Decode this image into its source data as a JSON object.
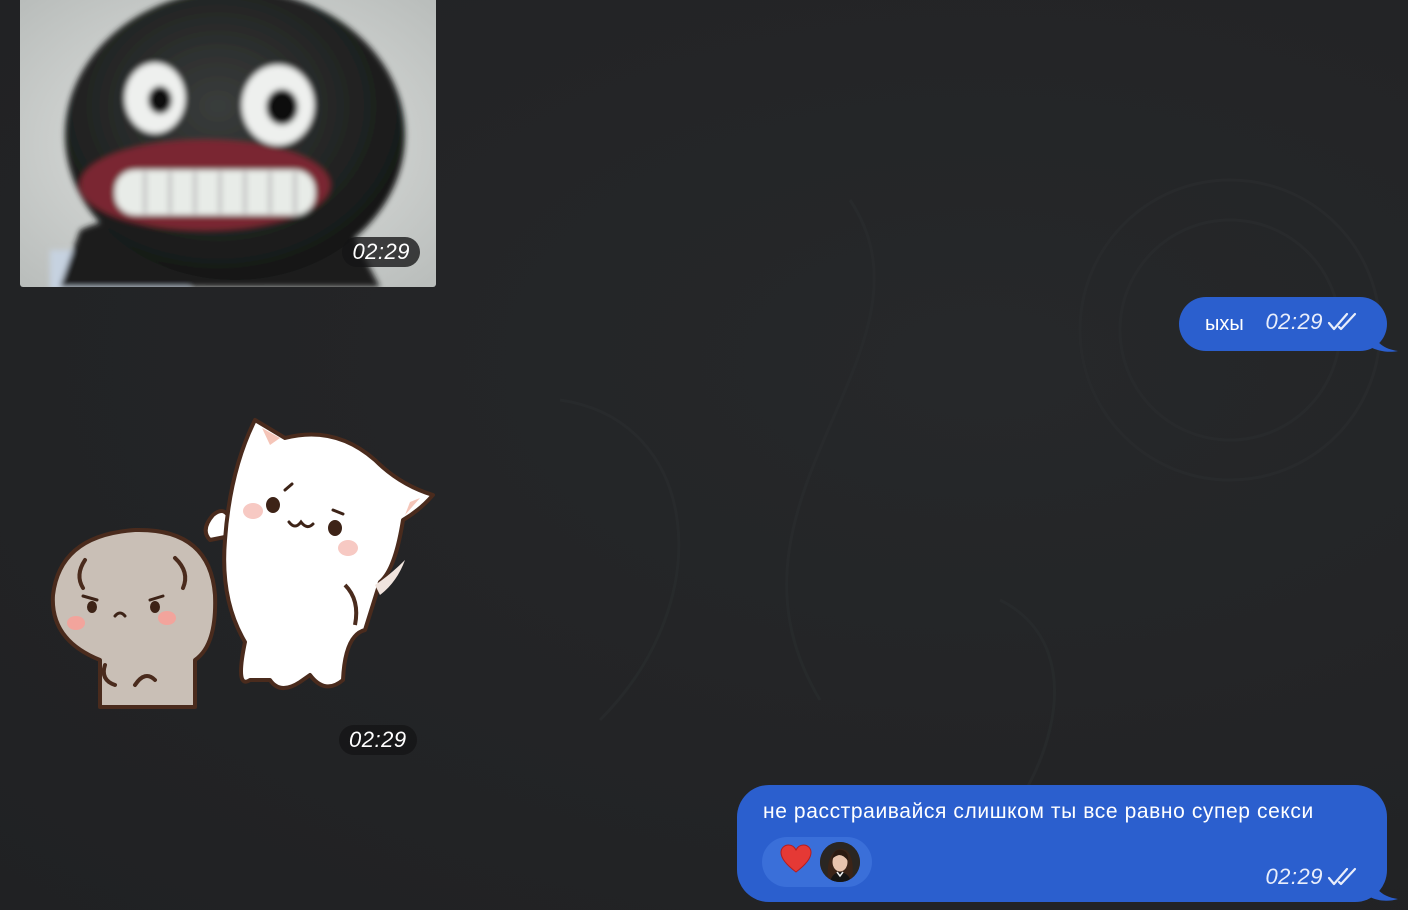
{
  "messages": [
    {
      "kind": "photo",
      "direction": "incoming",
      "time": "02:29"
    },
    {
      "kind": "text",
      "direction": "outgoing",
      "text": "ыхы",
      "time": "02:29",
      "status": "read"
    },
    {
      "kind": "sticker",
      "direction": "incoming",
      "time": "02:29"
    },
    {
      "kind": "text",
      "direction": "outgoing",
      "text": "не расстраивайся слишком ты все равно супер секси",
      "time": "02:29",
      "status": "read",
      "reactions": {
        "emoji": "❤️",
        "by": "avatar"
      }
    }
  ],
  "colors": {
    "background": "#232426",
    "outgoing_bubble": "#2b5fce",
    "reaction_pill": "#3a6fd9",
    "time_chip": "#141416"
  },
  "icons": [
    "double-check-icon",
    "heart-icon"
  ]
}
